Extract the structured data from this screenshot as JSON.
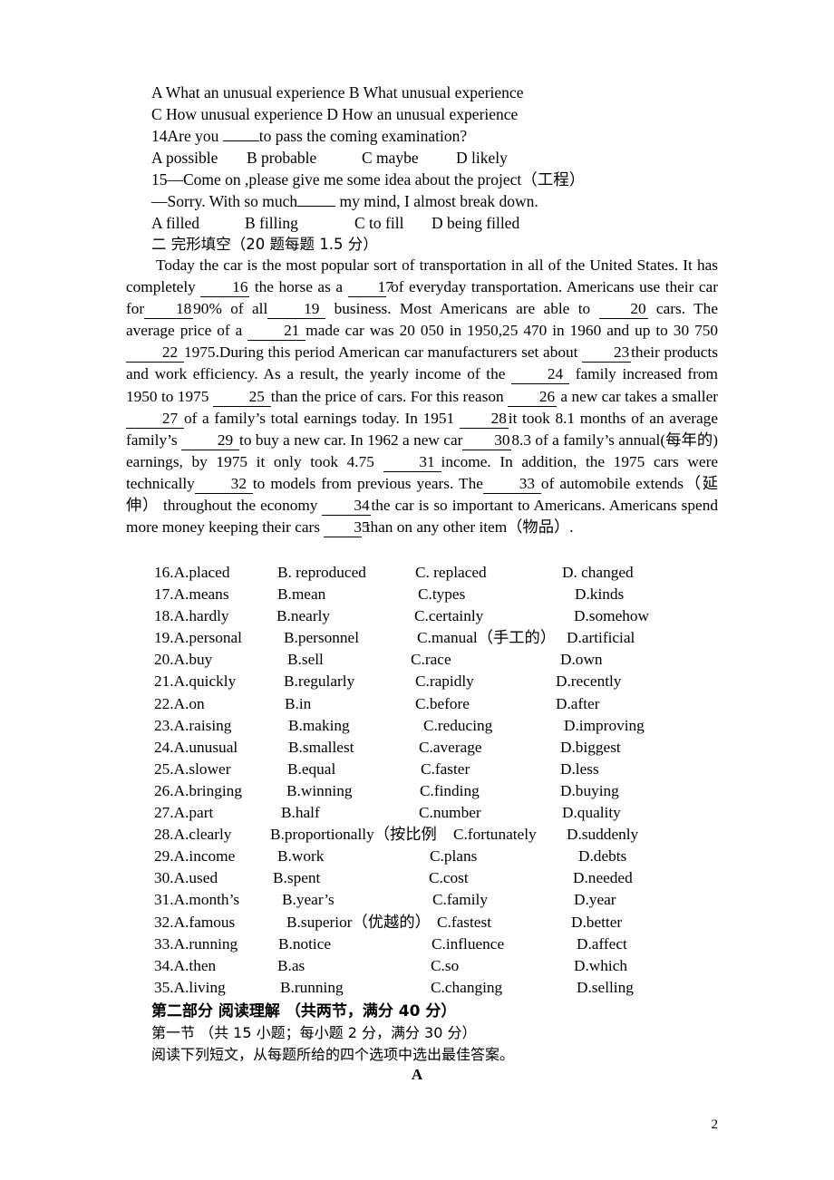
{
  "top_questions": [
    {
      "id": "q13-options-ab",
      "text": "A What an unusual experience      B What unusual experience"
    },
    {
      "id": "q13-options-cd",
      "text": "C How unusual experience           D How an unusual experience"
    },
    {
      "id": "q14-stem",
      "pre": "14Are you ",
      "blank": "",
      "post": "to pass the coming examination?"
    },
    {
      "id": "q14-options",
      "a": "A possible",
      "b": "B probable",
      "c": "C maybe",
      "d": "D likely"
    },
    {
      "id": "q15-stem-1",
      "text": "15—Come on ,please give me some idea about the project（工程）"
    },
    {
      "id": "q15-stem-2",
      "pre": "—Sorry. With so much",
      "blank": "",
      "post": " my mind, I almost break down."
    },
    {
      "id": "q15-options",
      "a": "A filled",
      "b": "B filling",
      "c": "C to fill",
      "d": "D being filled"
    }
  ],
  "cloze_heading": "二 完形填空（20 题每题 1.5 分）",
  "passage": {
    "s1": "Today the car is the most popular sort of transportation in all of the United States. It has completely ",
    "n16": "16",
    "s2": " the horse as a ",
    "n17": "17",
    "s3": " of everyday transportation. Americans use their car for",
    "n18": "18",
    "s4": "90% of all",
    "n19": "19",
    "s5": " business. Most Americans  are able to ",
    "n20": "20",
    "s6": " cars. The average price of a ",
    "n21": "21",
    "s7": "made car was 20 050 in 1950,25 470 in 1960 and up to 30 750 ",
    "n22": "22",
    "s8": "1975.During this period American car manufacturers set about ",
    "n23": "23",
    "s9": "their products and work efficiency. As a result, the yearly income of the ",
    "n24": "24",
    "s10": " family increased from 1950 to 1975 ",
    "n25": "25",
    "s11": "than the price of cars. For this reason ",
    "n26": "26",
    "s12": " a new car takes a smaller",
    "n27": "27",
    "s13": "of a family’s total earnings today. In 1951 ",
    "n28": "28",
    "s14": "it took 8.1 months of an average family’s ",
    "n29": "29",
    "s15": "to buy a new car. In 1962 a new car",
    "n30": "30",
    "s16": "8.3 of a family’s annual(每年的) earnings, by 1975 it only took 4.75 ",
    "n31": "31",
    "s17": "income. In addition, the 1975 cars were technically",
    "n32": "32",
    "s18": "to models from previous years. The",
    "n33": "33",
    "s19": "of automobile extends（延伸） throughout the economy ",
    "n34": "34",
    "s20": "the car is so important to Americans. Americans spend more money keeping their cars ",
    "n35": "35",
    "s21": " than on any other item（物品）."
  },
  "choices": [
    {
      "num": "16",
      "a": "16.A.placed",
      "b": "B. reproduced",
      "c": "C. replaced",
      "d": "D. changed"
    },
    {
      "num": "17",
      "a": "17.A.means",
      "b": "B.mean",
      "c": "C.types",
      "d": "D.kinds"
    },
    {
      "num": "18",
      "a": "18.A.hardly",
      "b": "B.nearly",
      "c": "C.certainly",
      "d": "D.somehow"
    },
    {
      "num": "19",
      "a": "19.A.personal",
      "b": "B.personnel",
      "c": "C.manual（手工的）",
      "d": "D.artificial"
    },
    {
      "num": "20",
      "a": "20.A.buy",
      "b": "B.sell",
      "c": "C.race",
      "d": "D.own"
    },
    {
      "num": "21",
      "a": "21.A.quickly",
      "b": "B.regularly",
      "c": "C.rapidly",
      "d": "D.recently"
    },
    {
      "num": "22",
      "a": "22.A.on",
      "b": "B.in",
      "c": "C.before",
      "d": "D.after"
    },
    {
      "num": "23",
      "a": "23.A.raising",
      "b": "B.making",
      "c": "C.reducing",
      "d": "D.improving"
    },
    {
      "num": "24",
      "a": "24.A.unusual",
      "b": "B.smallest",
      "c": "C.average",
      "d": "D.biggest"
    },
    {
      "num": "25",
      "a": "25.A.slower",
      "b": "B.equal",
      "c": "C.faster",
      "d": "D.less"
    },
    {
      "num": "26",
      "a": "26.A.bringing",
      "b": "B.winning",
      "c": "C.finding",
      "d": "D.buying"
    },
    {
      "num": "27",
      "a": "27.A.part",
      "b": "B.half",
      "c": "C.number",
      "d": "D.quality"
    },
    {
      "num": "28",
      "a": "28.A.clearly",
      "b": "B.proportionally（按比例",
      "c": "C.fortunately",
      "d": "D.suddenly"
    },
    {
      "num": "29",
      "a": "29.A.income",
      "b": "B.work",
      "c": "C.plans",
      "d": "D.debts"
    },
    {
      "num": "30",
      "a": "30.A.used",
      "b": "B.spent",
      "c": "C.cost",
      "d": "D.needed"
    },
    {
      "num": "31",
      "a": "31.A.month’s",
      "b": "B.year’s",
      "c": "C.family",
      "d": "D.year"
    },
    {
      "num": "32",
      "a": "32.A.famous",
      "b": "B.superior（优越的）",
      "c": "C.fastest",
      "d": "D.better"
    },
    {
      "num": "33",
      "a": "33.A.running",
      "b": "B.notice",
      "c": "C.influence",
      "d": "D.affect"
    },
    {
      "num": "34",
      "a": "34.A.then",
      "b": "B.as",
      "c": "C.so",
      "d": "D.which"
    },
    {
      "num": "35",
      "a": "35.A.living",
      "b": "B.running",
      "c": "C.changing",
      "d": "D.selling"
    }
  ],
  "bottom": {
    "part_heading": "第二部分   阅读理解 （共两节，满分 40 分）",
    "section_one": "第一节  （共 15 小题；每小题 2 分，满分 30 分）",
    "instruction": "阅读下列短文，从每题所给的四个选项中选出最佳答案。",
    "passage_mark": "A"
  },
  "page_number": "2"
}
